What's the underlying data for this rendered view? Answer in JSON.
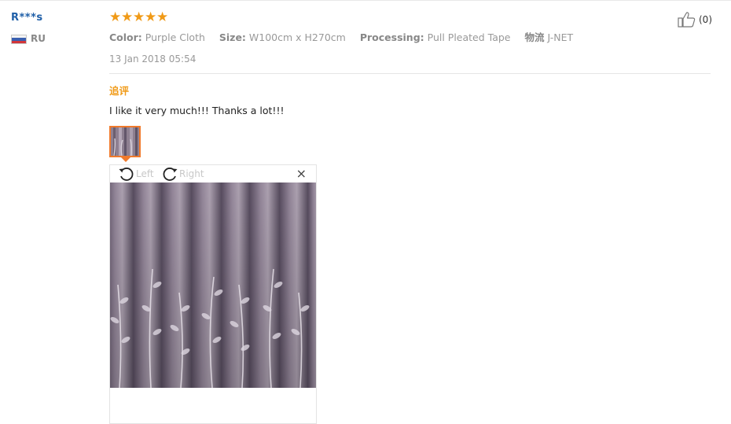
{
  "reviewer": {
    "name": "R***s",
    "country": "RU",
    "flag_icon": "russia-flag-icon"
  },
  "review": {
    "rating": 5,
    "stars": "★★★★★",
    "attributes": [
      {
        "key": "Color:",
        "value": "Purple Cloth"
      },
      {
        "key": "Size:",
        "value": "W100cm x H270cm"
      },
      {
        "key": "Processing:",
        "value": "Pull Pleated Tape"
      },
      {
        "key": "物流",
        "value": "J-NET"
      }
    ],
    "date": "13 Jan 2018 05:54",
    "additional_label": "追评",
    "comment": "I like it very much!!! Thanks a lot!!!"
  },
  "helpful": {
    "count": "(0)",
    "icon": "thumbs-up-icon"
  },
  "viewer": {
    "rotate_left_label": "Left",
    "rotate_right_label": "Right",
    "close_glyph": "×"
  },
  "colors": {
    "accent": "#f09a17",
    "thumb_border": "#f07a2c",
    "username": "#1f5fa8",
    "fabric": "#8e7f91"
  }
}
